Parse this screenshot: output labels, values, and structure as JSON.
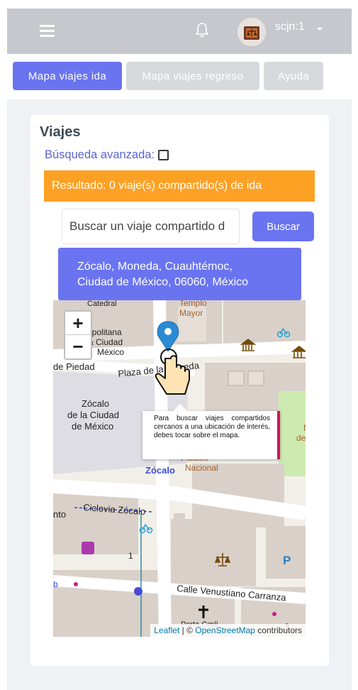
{
  "topbar": {
    "username": "scjn:1"
  },
  "tabs": [
    {
      "label": "Mapa viajes ida",
      "active": true
    },
    {
      "label": "Mapa viajes regreso",
      "active": false
    },
    {
      "label": "Ayuda",
      "active": false
    }
  ],
  "card": {
    "title": "Viajes",
    "advanced_search_label": "Búsqueda avanzada:",
    "advanced_search_checked": false,
    "result_text": "Resultado: 0 viaje(s) compartido(s) de ida",
    "search_placeholder": "Buscar un viaje compartido d",
    "search_button": "Buscar",
    "address_line1": "Zócalo, Moneda, Cuauhtémoc,",
    "address_line2": "Ciudad de México, 06060, México"
  },
  "map": {
    "zoom_in": "+",
    "zoom_out": "−",
    "tooltip": "Para buscar viajes compartidos cercanos a una ubicación de interés, debes tocar sobre el mapa.",
    "labels": {
      "metropolitana": "Metropolitana",
      "la_ciudad": "a Ciudad",
      "mexico_top": "México",
      "catedral": "Catedral",
      "templo": "Templo",
      "mayor": "Mayor",
      "de_piedad": "de Piedad",
      "plaza_moneda": "Plaza de la Moneda",
      "zocalo_big_1": "Zócalo",
      "zocalo_big_2": "de la Ciudad",
      "zocalo_big_3": "de México",
      "palacio": "Palacio",
      "nacional": "Nacional",
      "zocalo": "Zócalo",
      "ciclovia": "Ciclovia Zócalo",
      "nto": "nto",
      "calle_carranza": "Calle Venustiano Carranza",
      "porta_coeli": "Porta Cœli",
      "n_label": "N",
      "de_l": "de l",
      "number_1": "1",
      "b_label": "b"
    },
    "attribution": {
      "leaflet": "Leaflet",
      "separator": " | © ",
      "osm": "OpenStreetMap",
      "contributors": " contributors"
    }
  }
}
